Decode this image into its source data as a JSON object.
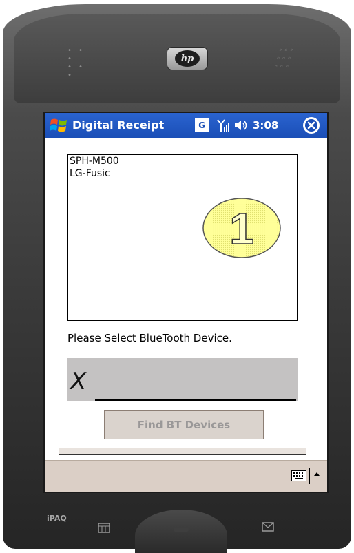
{
  "device": {
    "brand_logo": "hp",
    "model_label": "iPAQ"
  },
  "titlebar": {
    "app_title": "Digital Receipt",
    "g_label": "G",
    "clock": "3:08"
  },
  "device_list": {
    "items": [
      "SPH-M500",
      "LG-Fusic"
    ]
  },
  "badge": {
    "number": "1"
  },
  "prompt": "Please Select BlueTooth Device.",
  "signature": {
    "mark": "X"
  },
  "find_button": {
    "label": "Find BT Devices"
  },
  "colors": {
    "titlebar": "#2a63cf",
    "menubar": "#dbcfc6",
    "signature_pad": "#c4c2c2",
    "badge_fill": "#ffff99"
  },
  "icons": [
    "windows-start-icon",
    "g-icon",
    "signal-icon",
    "volume-icon",
    "close-icon",
    "keyboard-icon",
    "sip-arrow-icon",
    "calendar-key-icon",
    "mail-key-icon"
  ]
}
